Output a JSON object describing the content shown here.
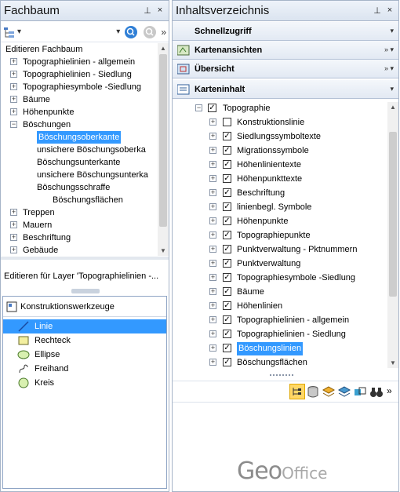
{
  "left_panel": {
    "title": "Fachbaum",
    "pin_glyph": "⊥",
    "close_glyph": "×",
    "toolbar_more": "»",
    "tree_root": "Editieren Fachbaum",
    "tree": [
      {
        "label": "Topographielinien - allgemein",
        "level": 1,
        "expander": "+"
      },
      {
        "label": "Topographielinien - Siedlung",
        "level": 1,
        "expander": "+"
      },
      {
        "label": "Topographiesymbole -Siedlung",
        "level": 1,
        "expander": "+"
      },
      {
        "label": "Bäume",
        "level": 1,
        "expander": "+"
      },
      {
        "label": "Höhenpunkte",
        "level": 1,
        "expander": "+"
      },
      {
        "label": "Böschungen",
        "level": 1,
        "expander": "−"
      },
      {
        "label": "Böschungsoberkante",
        "level": 2,
        "selected": true
      },
      {
        "label": "unsichere Böschungsoberka",
        "level": 2
      },
      {
        "label": "Böschungsunterkante",
        "level": 2
      },
      {
        "label": "unsichere Böschungsunterka",
        "level": 2
      },
      {
        "label": "Böschungsschraffe",
        "level": 2
      },
      {
        "label": "Böschungsflächen",
        "level": 3
      },
      {
        "label": "Treppen",
        "level": 1,
        "expander": "+"
      },
      {
        "label": "Mauern",
        "level": 1,
        "expander": "+"
      },
      {
        "label": "Beschriftung",
        "level": 1,
        "expander": "+"
      },
      {
        "label": "Gebäude",
        "level": 1,
        "expander": "+"
      }
    ],
    "layer_edit_label": "Editieren für Layer 'Topographielinien -...",
    "tools_header": "Konstruktionswerkzeuge",
    "tools": [
      {
        "label": "Linie",
        "icon": "line-icon",
        "selected": true
      },
      {
        "label": "Rechteck",
        "icon": "rectangle-icon"
      },
      {
        "label": "Ellipse",
        "icon": "ellipse-icon"
      },
      {
        "label": "Freihand",
        "icon": "freehand-icon"
      },
      {
        "label": "Kreis",
        "icon": "circle-icon"
      }
    ]
  },
  "right_panel": {
    "title": "Inhaltsverzeichnis",
    "pin_glyph": "⊥",
    "close_glyph": "×",
    "sections": [
      {
        "label": "Schnellzugriff",
        "arrows": "▾"
      },
      {
        "label": "Kartenansichten",
        "arrows": "» ▾"
      },
      {
        "label": "Übersicht",
        "arrows": "» ▾"
      },
      {
        "label": "Karteninhalt",
        "arrows": "▾"
      }
    ],
    "root": {
      "label": "Topographie",
      "checked": true,
      "expander": "−"
    },
    "layers": [
      {
        "label": "Konstruktionslinie",
        "checked": false
      },
      {
        "label": "Siedlungssymboltexte",
        "checked": true
      },
      {
        "label": "Migrationssymbole",
        "checked": true
      },
      {
        "label": "Höhenlinientexte",
        "checked": true
      },
      {
        "label": "Höhenpunkttexte",
        "checked": true
      },
      {
        "label": "Beschriftung",
        "checked": true
      },
      {
        "label": "linienbegl. Symbole",
        "checked": true
      },
      {
        "label": "Höhenpunkte",
        "checked": true
      },
      {
        "label": "Topographiepunkte",
        "checked": true
      },
      {
        "label": "Punktverwaltung - Pktnummern",
        "checked": true
      },
      {
        "label": "Punktverwaltung",
        "checked": true
      },
      {
        "label": "Topographiesymbole -Siedlung",
        "checked": true
      },
      {
        "label": "Bäume",
        "checked": true
      },
      {
        "label": "Höhenlinien",
        "checked": true
      },
      {
        "label": "Topographielinien - allgemein",
        "checked": true
      },
      {
        "label": "Topographielinien - Siedlung",
        "checked": true
      },
      {
        "label": "Böschungslinien",
        "checked": true,
        "selected": true
      },
      {
        "label": "Böschungsflächen",
        "checked": true
      }
    ],
    "toolbar_more": "»",
    "logo_geo": "Geo",
    "logo_office": "Office"
  },
  "colors": {
    "selection": "#3399ff",
    "header_gradient_top": "#eef3fa",
    "border": "#a6b4c8"
  }
}
